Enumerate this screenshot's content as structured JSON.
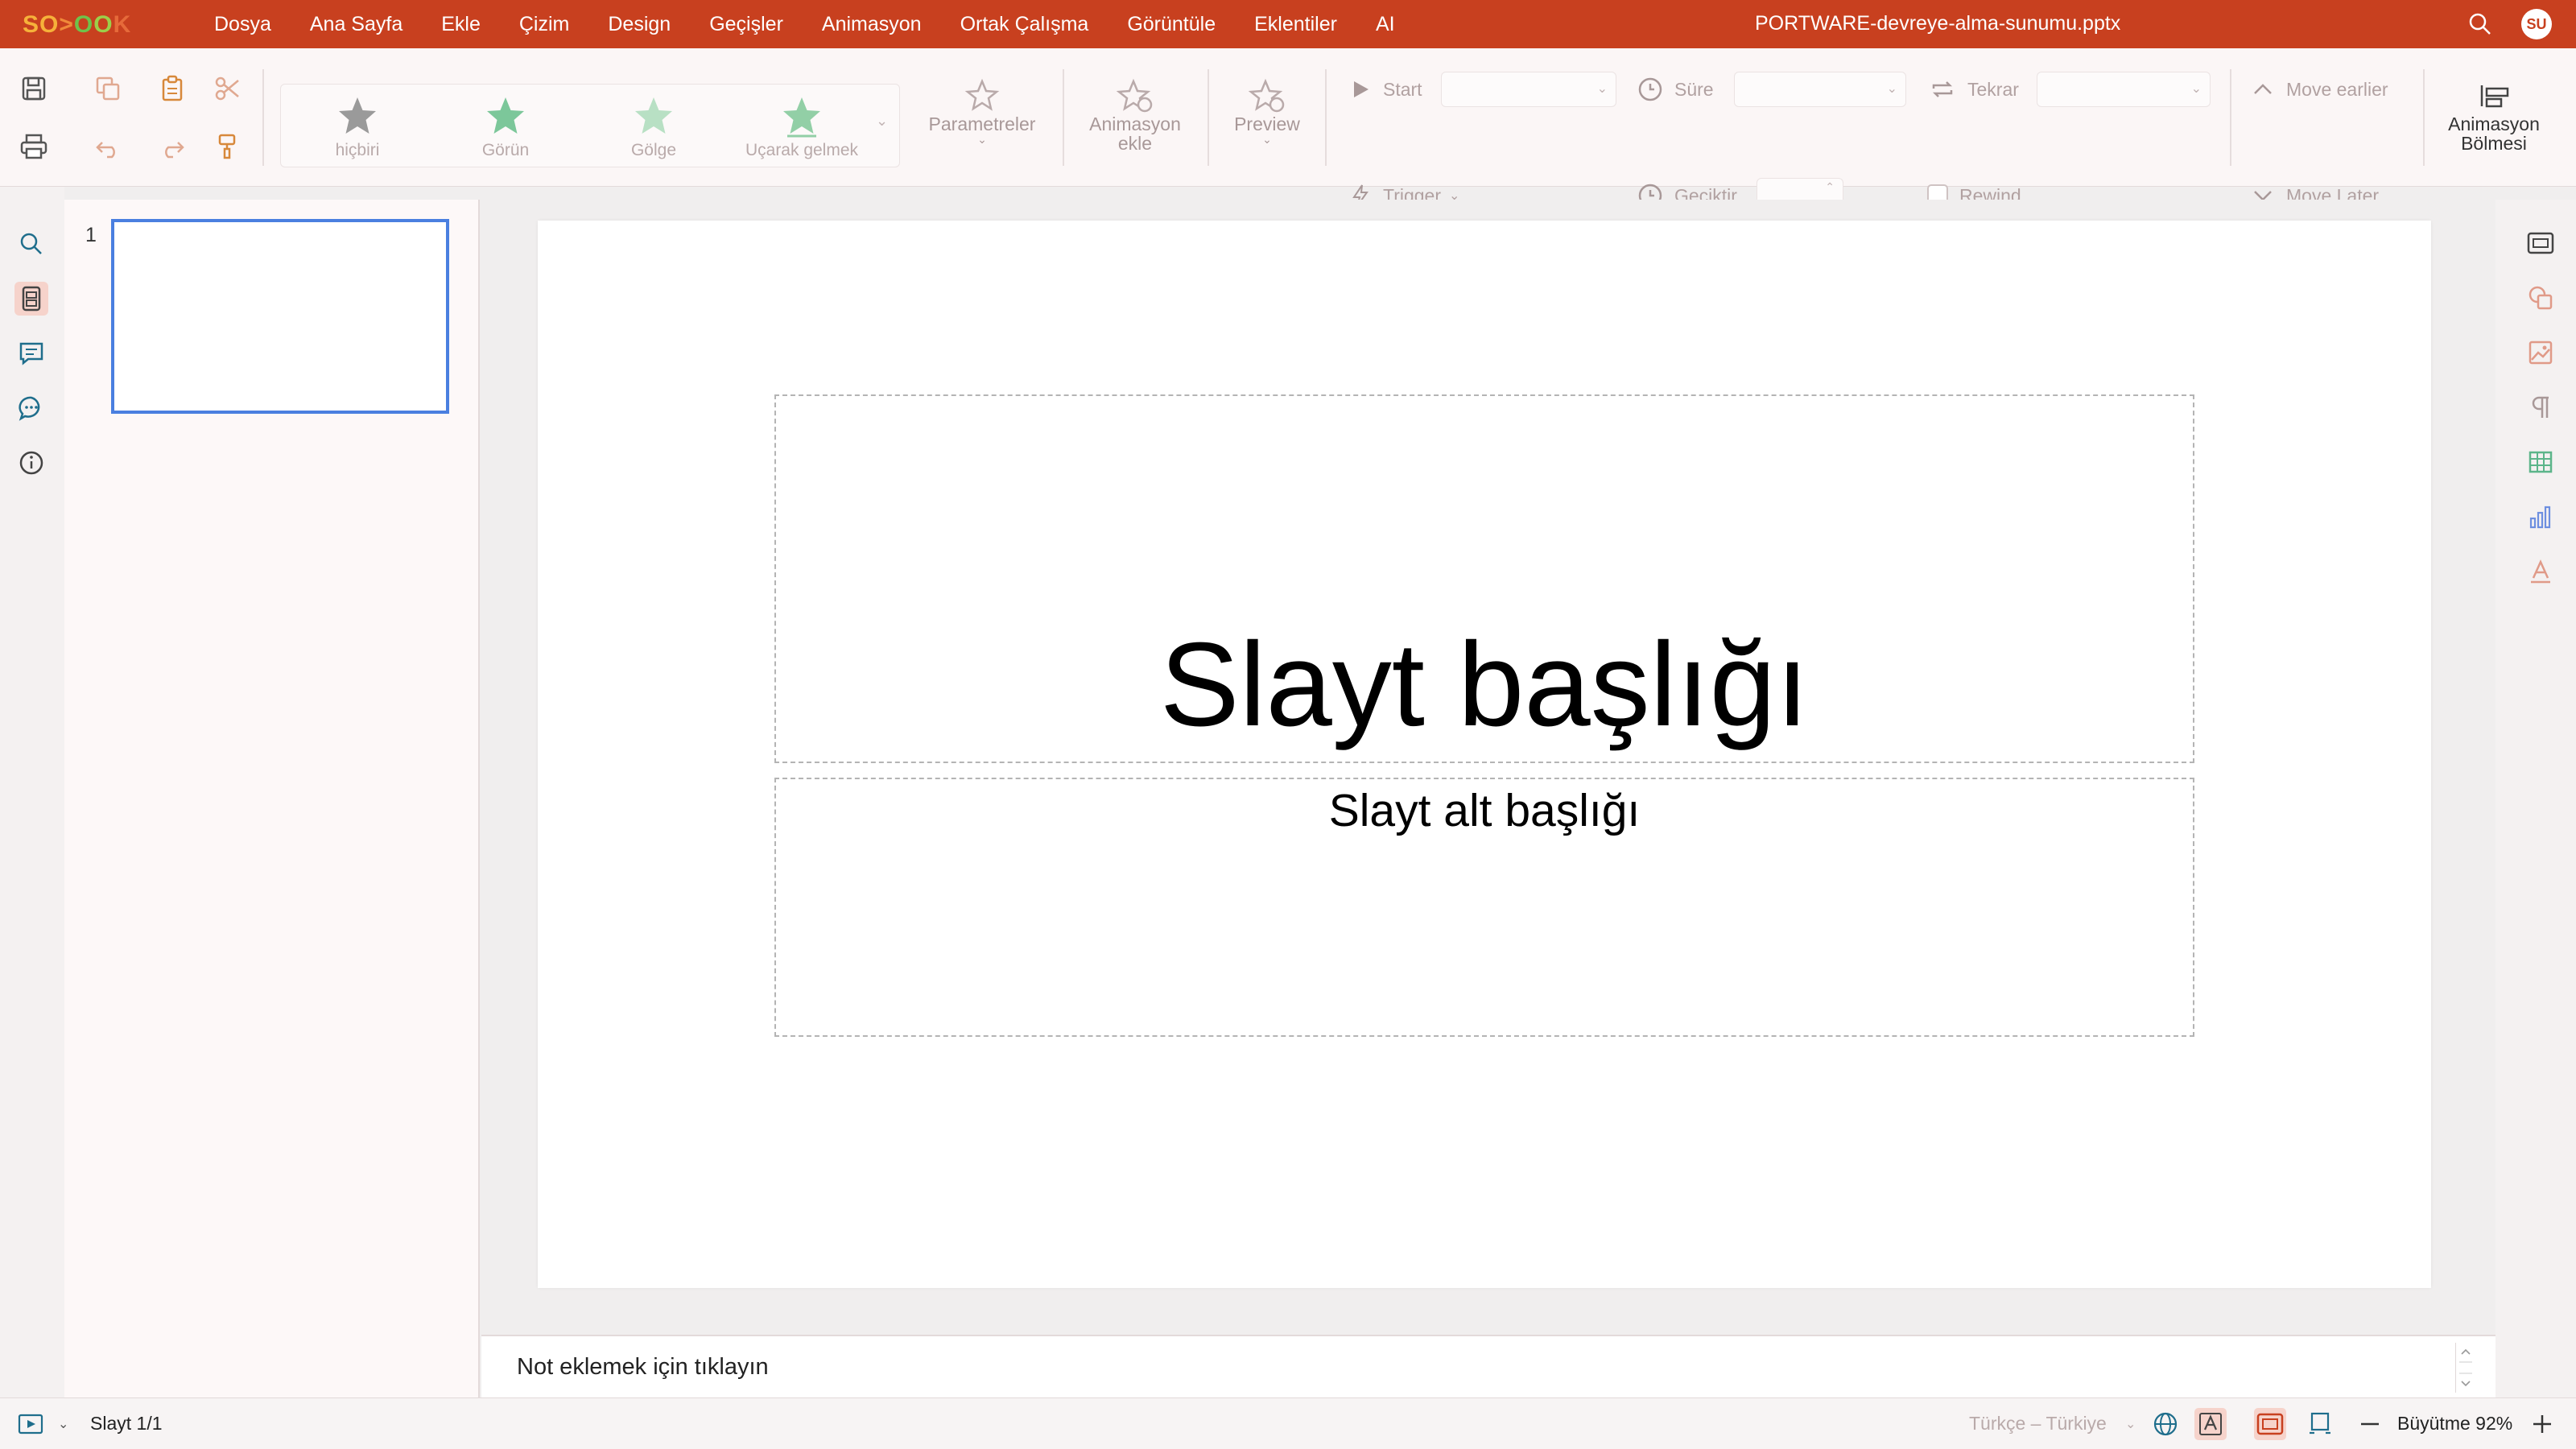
{
  "app": {
    "logo_text": "SO>OOK",
    "document_title": "PORTWARE-devreye-alma-sunumu.pptx",
    "avatar_initials": "SU",
    "accent_color": "#c8401f"
  },
  "menu": {
    "items": [
      "Dosya",
      "Ana Sayfa",
      "Ekle",
      "Çizim",
      "Design",
      "Geçişler",
      "Animasyon",
      "Ortak Çalışma",
      "Görüntüle",
      "Eklentiler",
      "AI"
    ]
  },
  "ribbon": {
    "quick_icons": [
      "save-icon",
      "copy-icon",
      "paste-icon",
      "cut-icon",
      "print-icon",
      "undo-icon",
      "redo-icon",
      "format-painter-icon"
    ],
    "effects": [
      "hiçbiri",
      "Görün",
      "Gölge",
      "Uçarak gelmek"
    ],
    "parameters_label": "Parametreler",
    "add_animation_label_1": "Animasyon",
    "add_animation_label_2": "ekle",
    "preview_label": "Preview",
    "start_label": "Start",
    "trigger_label": "Trigger",
    "duration_label": "Süre",
    "delay_label": "Geciktir",
    "repeat_label": "Tekrar",
    "rewind_label": "Rewind",
    "move_earlier_label": "Move earlier",
    "move_later_label": "Move Later",
    "animation_pane_label_1": "Animasyon",
    "animation_pane_label_2": "Bölmesi"
  },
  "left_rail": {
    "icons": [
      "search-icon",
      "slides-icon",
      "comments-icon",
      "chat-icon",
      "info-icon"
    ]
  },
  "thumbnails": [
    {
      "number": "1"
    }
  ],
  "slide": {
    "title": "Slayt başlığı",
    "subtitle": "Slayt alt başlığı"
  },
  "right_rail": {
    "icons": [
      "slide-settings-icon",
      "shape-settings-icon",
      "image-settings-icon",
      "paragraph-settings-icon",
      "table-settings-icon",
      "chart-settings-icon",
      "text-art-settings-icon"
    ]
  },
  "notes": {
    "placeholder": "Not eklemek için tıklayın"
  },
  "status": {
    "slide_counter": "Slayt 1/1",
    "language": "Türkçe – Türkiye",
    "zoom_label": "Büyütme 92%"
  }
}
